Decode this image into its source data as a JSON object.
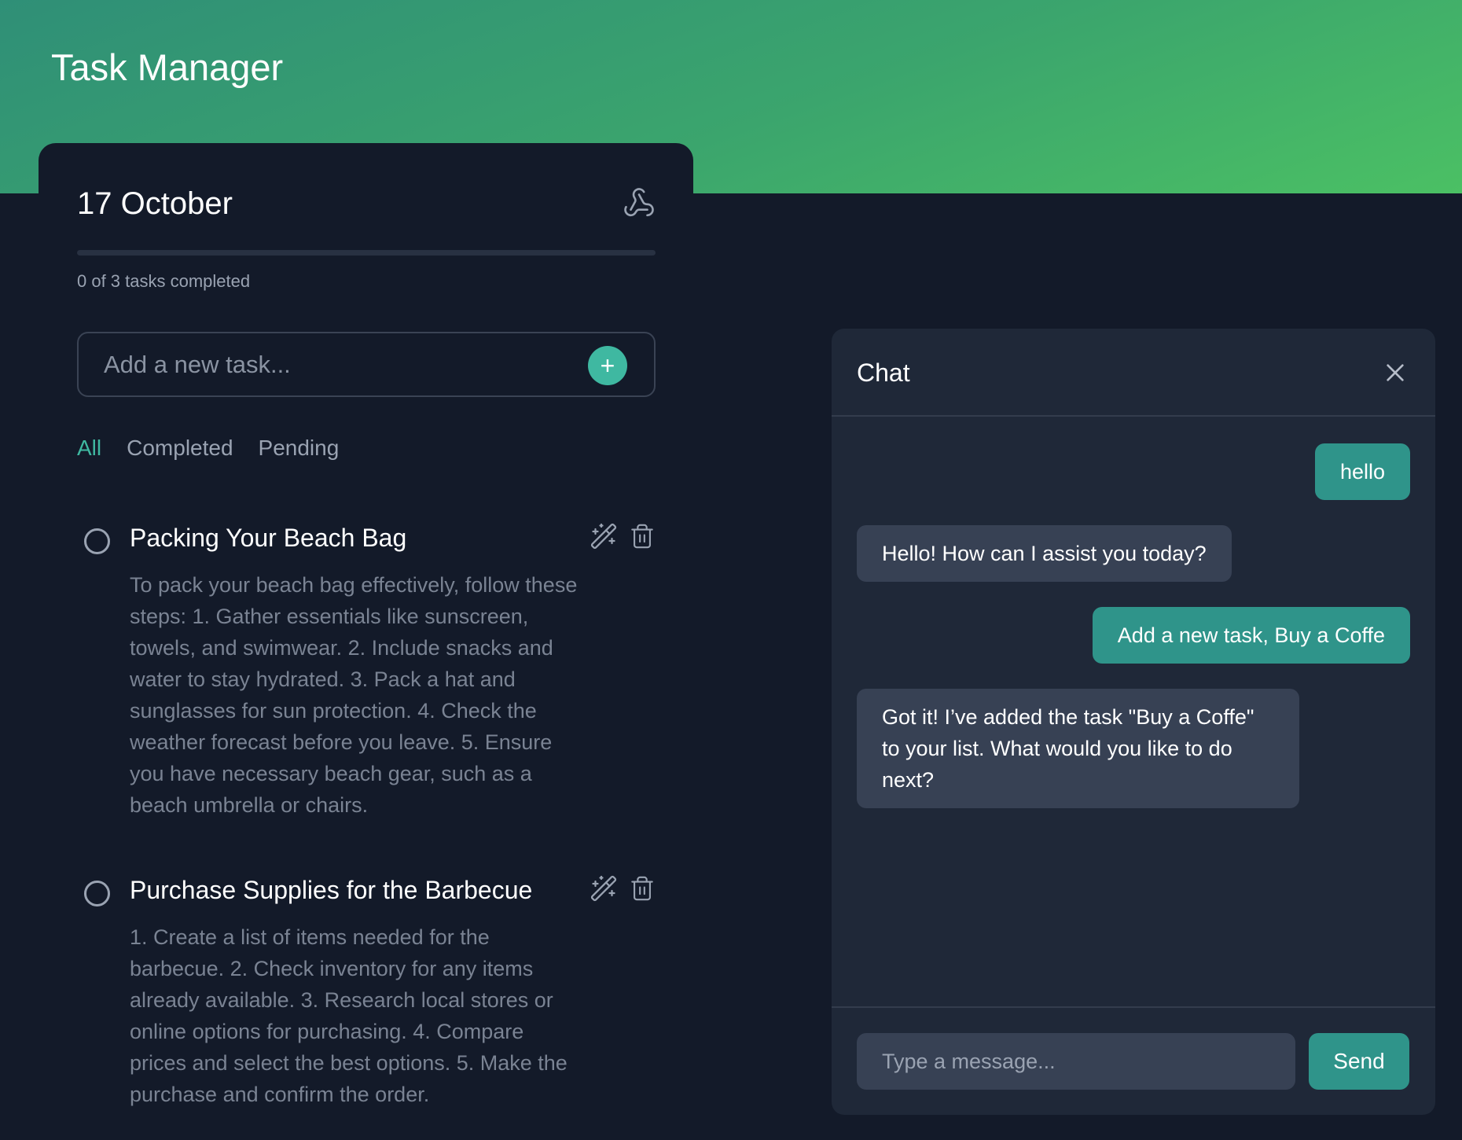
{
  "app": {
    "title": "Task Manager"
  },
  "tasks_panel": {
    "date": "17 October",
    "progress_text": "0 of 3 tasks completed",
    "progress_fraction": 0,
    "input_placeholder": "Add a new task...",
    "add_icon": "+",
    "filters": [
      "All",
      "Completed",
      "Pending"
    ],
    "active_filter": "All",
    "tasks": [
      {
        "title": "Packing Your Beach Bag",
        "description": "To pack your beach bag effectively, follow these steps: 1. Gather essentials like sunscreen, towels, and swimwear. 2. Include snacks and water to stay hydrated. 3. Pack a hat and sunglasses for sun protection. 4. Check the weather forecast before you leave. 5. Ensure you have necessary beach gear, such as a beach umbrella or chairs.",
        "completed": false
      },
      {
        "title": "Purchase Supplies for the Barbecue",
        "description": "1. Create a list of items needed for the barbecue. 2. Check inventory for any items already available. 3. Research local stores or online options for purchasing. 4. Compare prices and select the best options. 5. Make the purchase and confirm the order.",
        "completed": false
      }
    ]
  },
  "chat": {
    "title": "Chat",
    "messages": [
      {
        "role": "user",
        "text": "hello"
      },
      {
        "role": "bot",
        "text": "Hello! How can I assist you today?"
      },
      {
        "role": "user",
        "text": "Add a new task, Buy a Coffe"
      },
      {
        "role": "bot",
        "text": "Got it! I’ve added the task \"Buy a Coffe\" to your list. What would you like to do next?"
      }
    ],
    "input_placeholder": "Type a message...",
    "send_label": "Send"
  },
  "colors": {
    "accent": "#3fb8a1",
    "chat_user_bubble": "#2f948a",
    "chat_bot_bubble": "#374154",
    "background": "#131a29",
    "header_gradient_start": "#2f8f77",
    "header_gradient_end": "#4bc064"
  },
  "icons": {
    "header_icon": "webhook-icon",
    "task_actions": [
      "magic-wand-icon",
      "trash-icon"
    ],
    "chat_close": "close-icon"
  }
}
